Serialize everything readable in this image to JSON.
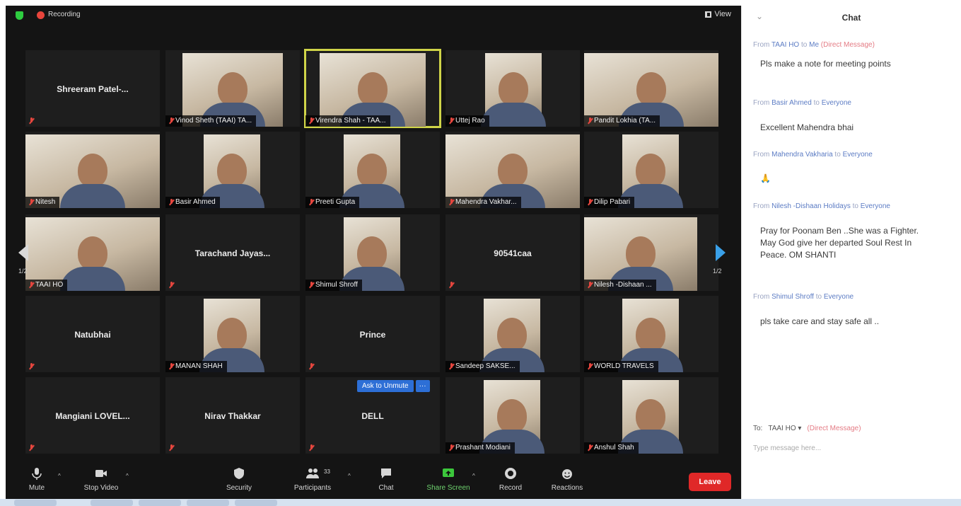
{
  "top_bar": {
    "recording": "Recording",
    "view": "View"
  },
  "tiles": [
    {
      "name": "Shreeram Patel-...",
      "video": false
    },
    {
      "name": "Vinod Sheth (TAAI) TA...",
      "video": true
    },
    {
      "name": "Virendra Shah - TAA...",
      "video": true,
      "active": true
    },
    {
      "name": "Uttej Rao",
      "video": true
    },
    {
      "name": "Pandit Lokhia (TA...",
      "video": true
    },
    {
      "name": "Nitesh",
      "video": true
    },
    {
      "name": "Basir Ahmed",
      "video": true
    },
    {
      "name": "Preeti Gupta",
      "video": true
    },
    {
      "name": "Mahendra Vakhar...",
      "video": true
    },
    {
      "name": "Dilip Pabari",
      "video": true
    },
    {
      "name": "TAAI HO",
      "video": true
    },
    {
      "name": "Tarachand Jayas...",
      "video": false
    },
    {
      "name": "Shimul Shroff",
      "video": true
    },
    {
      "name": "90541caa",
      "video": false
    },
    {
      "name": "Nilesh -Dishaan ...",
      "video": true
    },
    {
      "name": "Natubhai",
      "video": false
    },
    {
      "name": "MANAN SHAH",
      "video": true
    },
    {
      "name": "Prince",
      "video": false
    },
    {
      "name": "Sandeep SAKSE...",
      "video": true
    },
    {
      "name": "WORLD TRAVELS",
      "video": true
    },
    {
      "name": "Mangiani LOVEL...",
      "video": false
    },
    {
      "name": "Nirav Thakkar",
      "video": false
    },
    {
      "name": "DELL",
      "video": false
    },
    {
      "name": "Prashant Modiani",
      "video": true
    },
    {
      "name": "Anshul Shah",
      "video": true
    }
  ],
  "donate": {
    "label": "Ask to Unmute",
    "more": "···"
  },
  "pagination": {
    "left": "1/2",
    "right": "1/2"
  },
  "toolbar": {
    "mute": "Mute",
    "stop_video": "Stop Video",
    "security": "Security",
    "participants": "Participants",
    "participants_count": "33",
    "chat": "Chat",
    "share_screen": "Share Screen",
    "record": "Record",
    "reactions": "Reactions",
    "leave": "Leave"
  },
  "chat": {
    "title": "Chat",
    "messages": [
      {
        "from_prefix": "From",
        "sender": "TAAI HO",
        "to": "to",
        "recipient": "Me",
        "tag": "(Direct Message)",
        "text": "Pls make a note for meeting points"
      },
      {
        "from_prefix": "From",
        "sender": "Basir Ahmed",
        "to": "to",
        "recipient": "Everyone",
        "tag": "",
        "text": "Excellent Mahendra bhai"
      },
      {
        "from_prefix": "From",
        "sender": "Mahendra Vakharia",
        "to": "to",
        "recipient": "Everyone",
        "tag": "",
        "text": "🙏"
      },
      {
        "from_prefix": "From",
        "sender": "Nilesh -Dishaan Holidays",
        "to": "to",
        "recipient": "Everyone",
        "tag": "",
        "text": "Pray for Poonam Ben ..She was a Fighter. May God give her departed Soul Rest In Peace. OM SHANTI"
      },
      {
        "from_prefix": "From",
        "sender": "Shimul Shroff",
        "to": "to",
        "recipient": "Everyone",
        "tag": "",
        "text": "pls take care and stay safe all .."
      }
    ],
    "to_label": "To:",
    "to_value": "TAAI HO ▾",
    "to_tag": "(Direct Message)",
    "placeholder": "Type message here..."
  }
}
